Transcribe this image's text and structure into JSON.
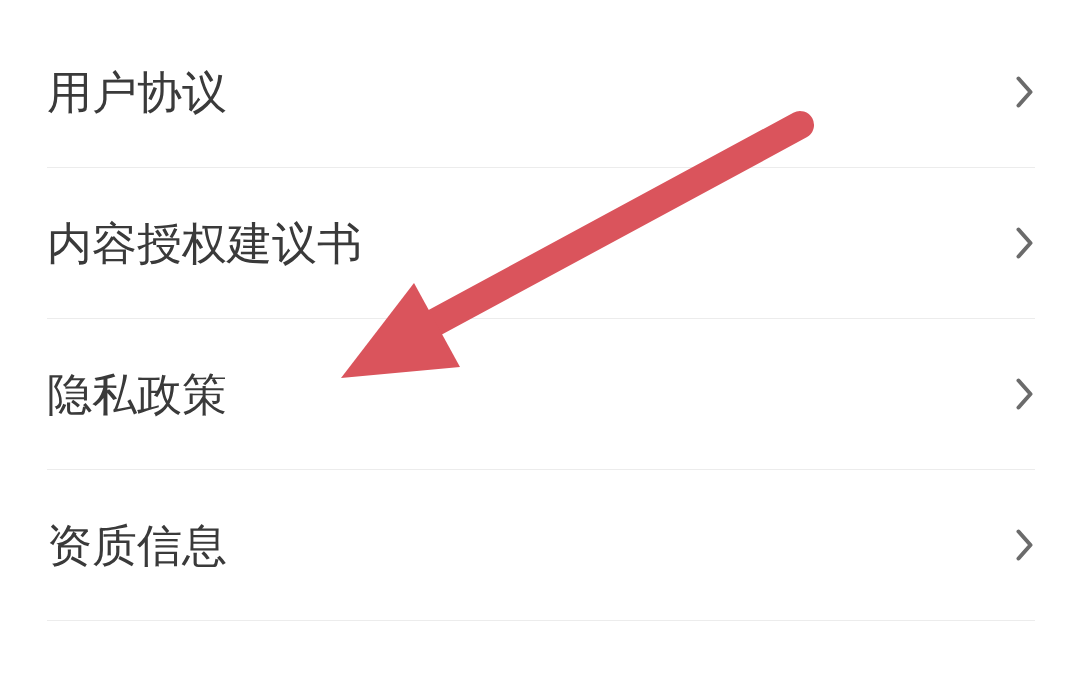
{
  "settings_list": {
    "items": [
      {
        "label": "用户协议"
      },
      {
        "label": "内容授权建议书"
      },
      {
        "label": "隐私政策"
      },
      {
        "label": "资质信息"
      }
    ]
  }
}
